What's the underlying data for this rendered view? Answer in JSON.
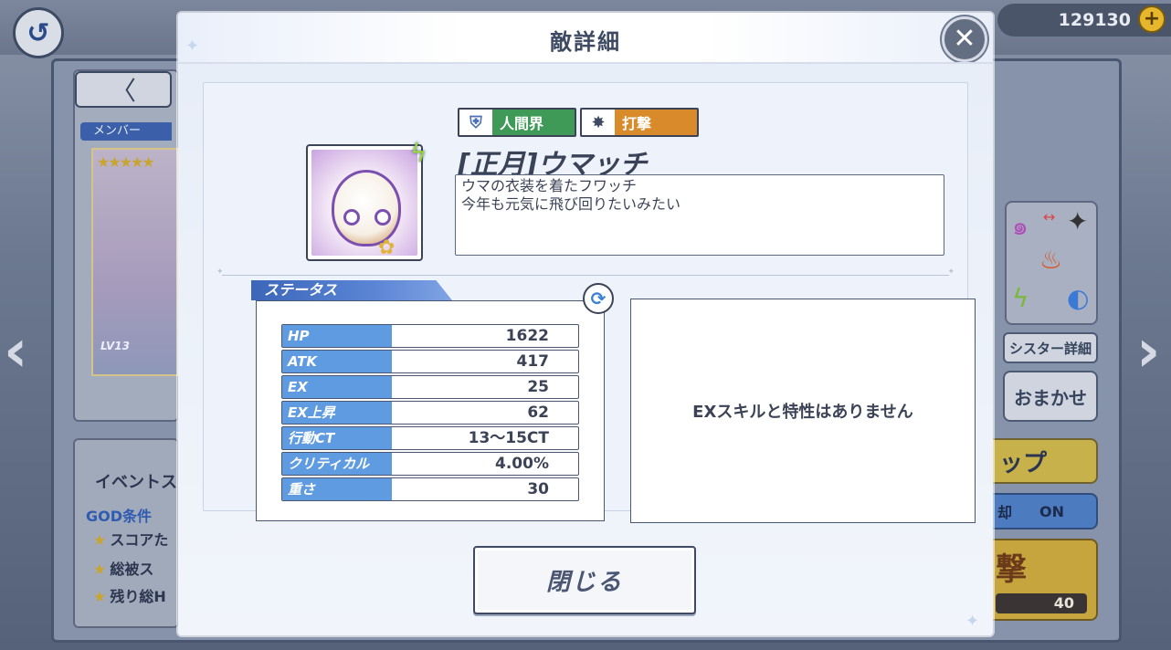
{
  "background": {
    "coins": "129130",
    "member_tag": "メンバー",
    "card_level": "LV13",
    "card_stars": "★★★★★",
    "event_title": "イベントス",
    "god_label": "GOD条件",
    "god_rows": [
      "スコアた",
      "総被ス",
      "残り総H"
    ],
    "sister_detail": "シスター詳細",
    "omakase": "おまかせ",
    "yellow_btn": "ップ",
    "toggle_left": "却",
    "toggle_right": "ON",
    "attack_label": "撃",
    "attack_count": "40"
  },
  "modal": {
    "title": "敵詳細",
    "race_badge": "人間界",
    "attr_badge": "打撃",
    "enemy_name": "[正月]ウマッチ",
    "description": "ウマの衣装を着たフワッチ\n今年も元気に飛び回りたいみたい",
    "status_tab": "ステータス",
    "stats": [
      {
        "label": "HP",
        "value": "1622"
      },
      {
        "label": "ATK",
        "value": "417"
      },
      {
        "label": "EX",
        "value": "25"
      },
      {
        "label": "EX上昇",
        "value": "62"
      },
      {
        "label": "行動CT",
        "value": "13〜15CT"
      },
      {
        "label": "クリティカル",
        "value": "4.00%"
      },
      {
        "label": "重さ",
        "value": "30"
      }
    ],
    "ex_skill_text": "EXスキルと特性はありません",
    "close_button": "閉じる"
  }
}
